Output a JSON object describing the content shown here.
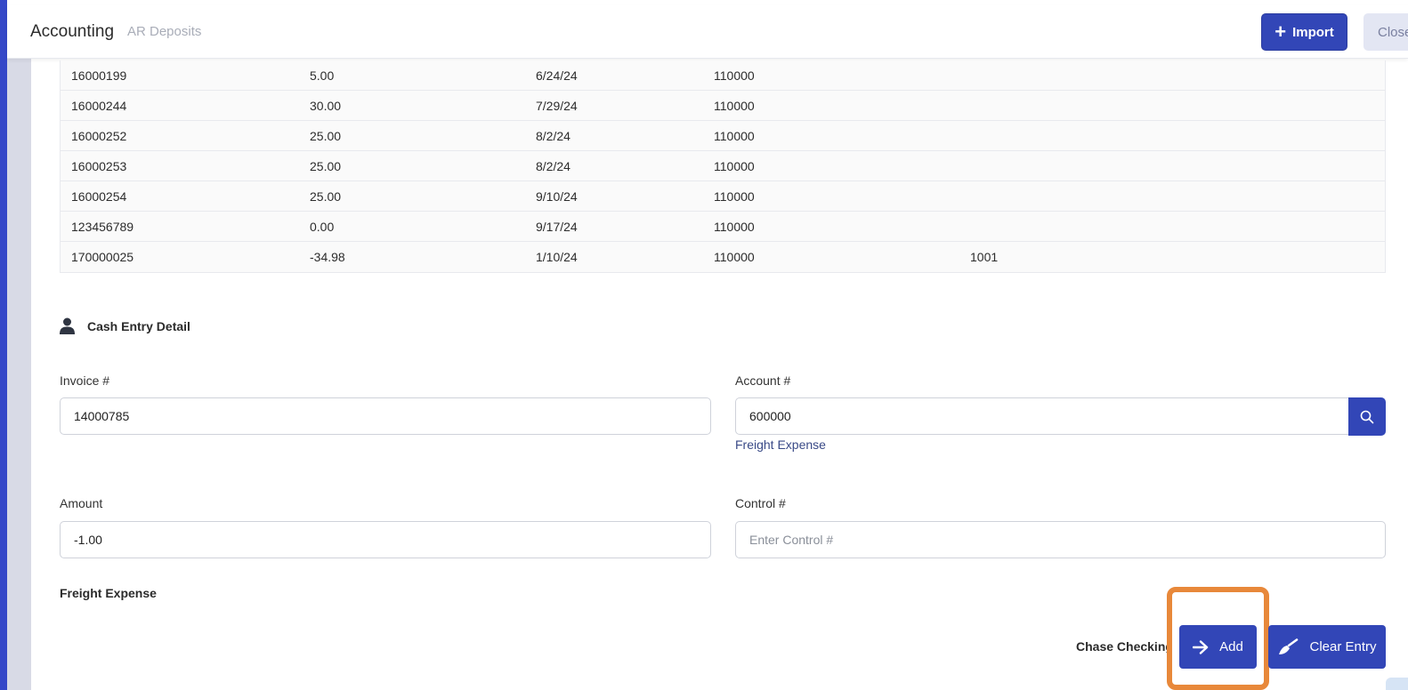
{
  "header": {
    "title": "Accounting",
    "breadcrumb": "AR Deposits",
    "import_label": "Import",
    "close_label": "Close"
  },
  "table": {
    "rows": [
      [
        "16000199",
        "5.00",
        "6/24/24",
        "110000",
        ""
      ],
      [
        "16000244",
        "30.00",
        "7/29/24",
        "110000",
        ""
      ],
      [
        "16000252",
        "25.00",
        "8/2/24",
        "110000",
        ""
      ],
      [
        "16000253",
        "25.00",
        "8/2/24",
        "110000",
        ""
      ],
      [
        "16000254",
        "25.00",
        "9/10/24",
        "110000",
        ""
      ],
      [
        "123456789",
        "0.00",
        "9/17/24",
        "110000",
        ""
      ],
      [
        "170000025",
        "-34.98",
        "1/10/24",
        "110000",
        "1001"
      ]
    ]
  },
  "section": {
    "title": "Cash Entry Detail"
  },
  "form": {
    "invoice_label": "Invoice #",
    "invoice_value": "14000785",
    "account_label": "Account #",
    "account_value": "600000",
    "account_hint": "Freight Expense",
    "amount_label": "Amount",
    "amount_value": "-1.00",
    "control_label": "Control #",
    "control_placeholder": "Enter Control #"
  },
  "footer": {
    "description": "Freight Expense",
    "bank_account": "Chase Checking",
    "add_label": "Add",
    "clear_label": "Clear Entry"
  },
  "colors": {
    "primary": "#3246b7",
    "highlight": "#e8883a",
    "hint": "#3a4a87"
  }
}
